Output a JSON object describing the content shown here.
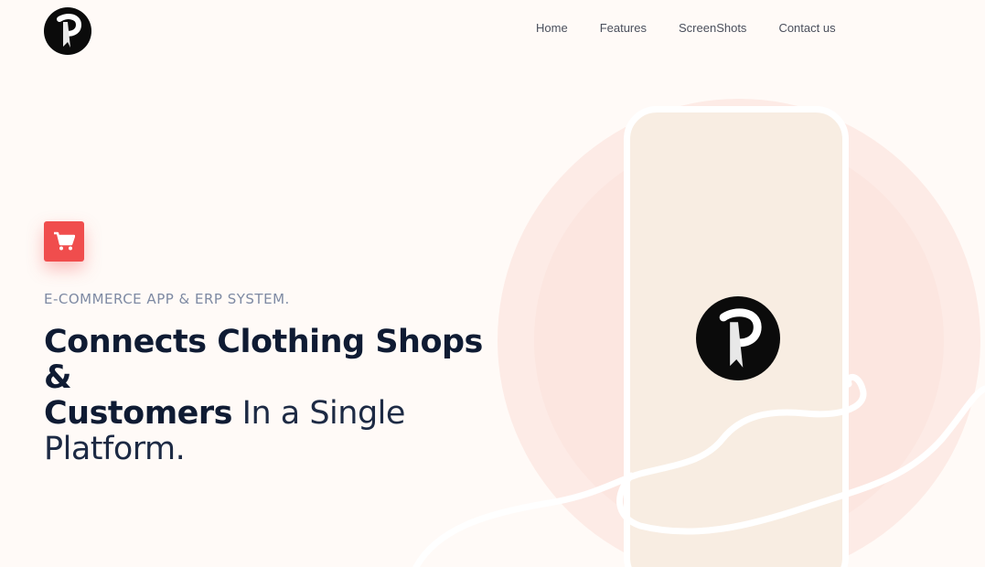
{
  "nav": {
    "items": [
      {
        "label": "Home"
      },
      {
        "label": "Features"
      },
      {
        "label": "ScreenShots"
      },
      {
        "label": "Contact us"
      }
    ]
  },
  "hero": {
    "eyebrow": "E-COMMERCE APP & ERP SYSTEM.",
    "headline_bold_1": "Connects Clothing Shops &",
    "headline_bold_2": "Customers",
    "headline_light_1": " In a Single",
    "headline_light_2": "Platform.",
    "badge_icon": "shopping-cart-icon"
  },
  "brand": {
    "logo_letter": "P",
    "logo_icon": "brand-logo-icon"
  },
  "colors": {
    "accent": "#f04d4d",
    "background": "#fffaf7",
    "circle": "#fdebe6",
    "phone_screen": "#f8ede2",
    "heading": "#0f1b33",
    "eyebrow": "#7e8aa3"
  }
}
